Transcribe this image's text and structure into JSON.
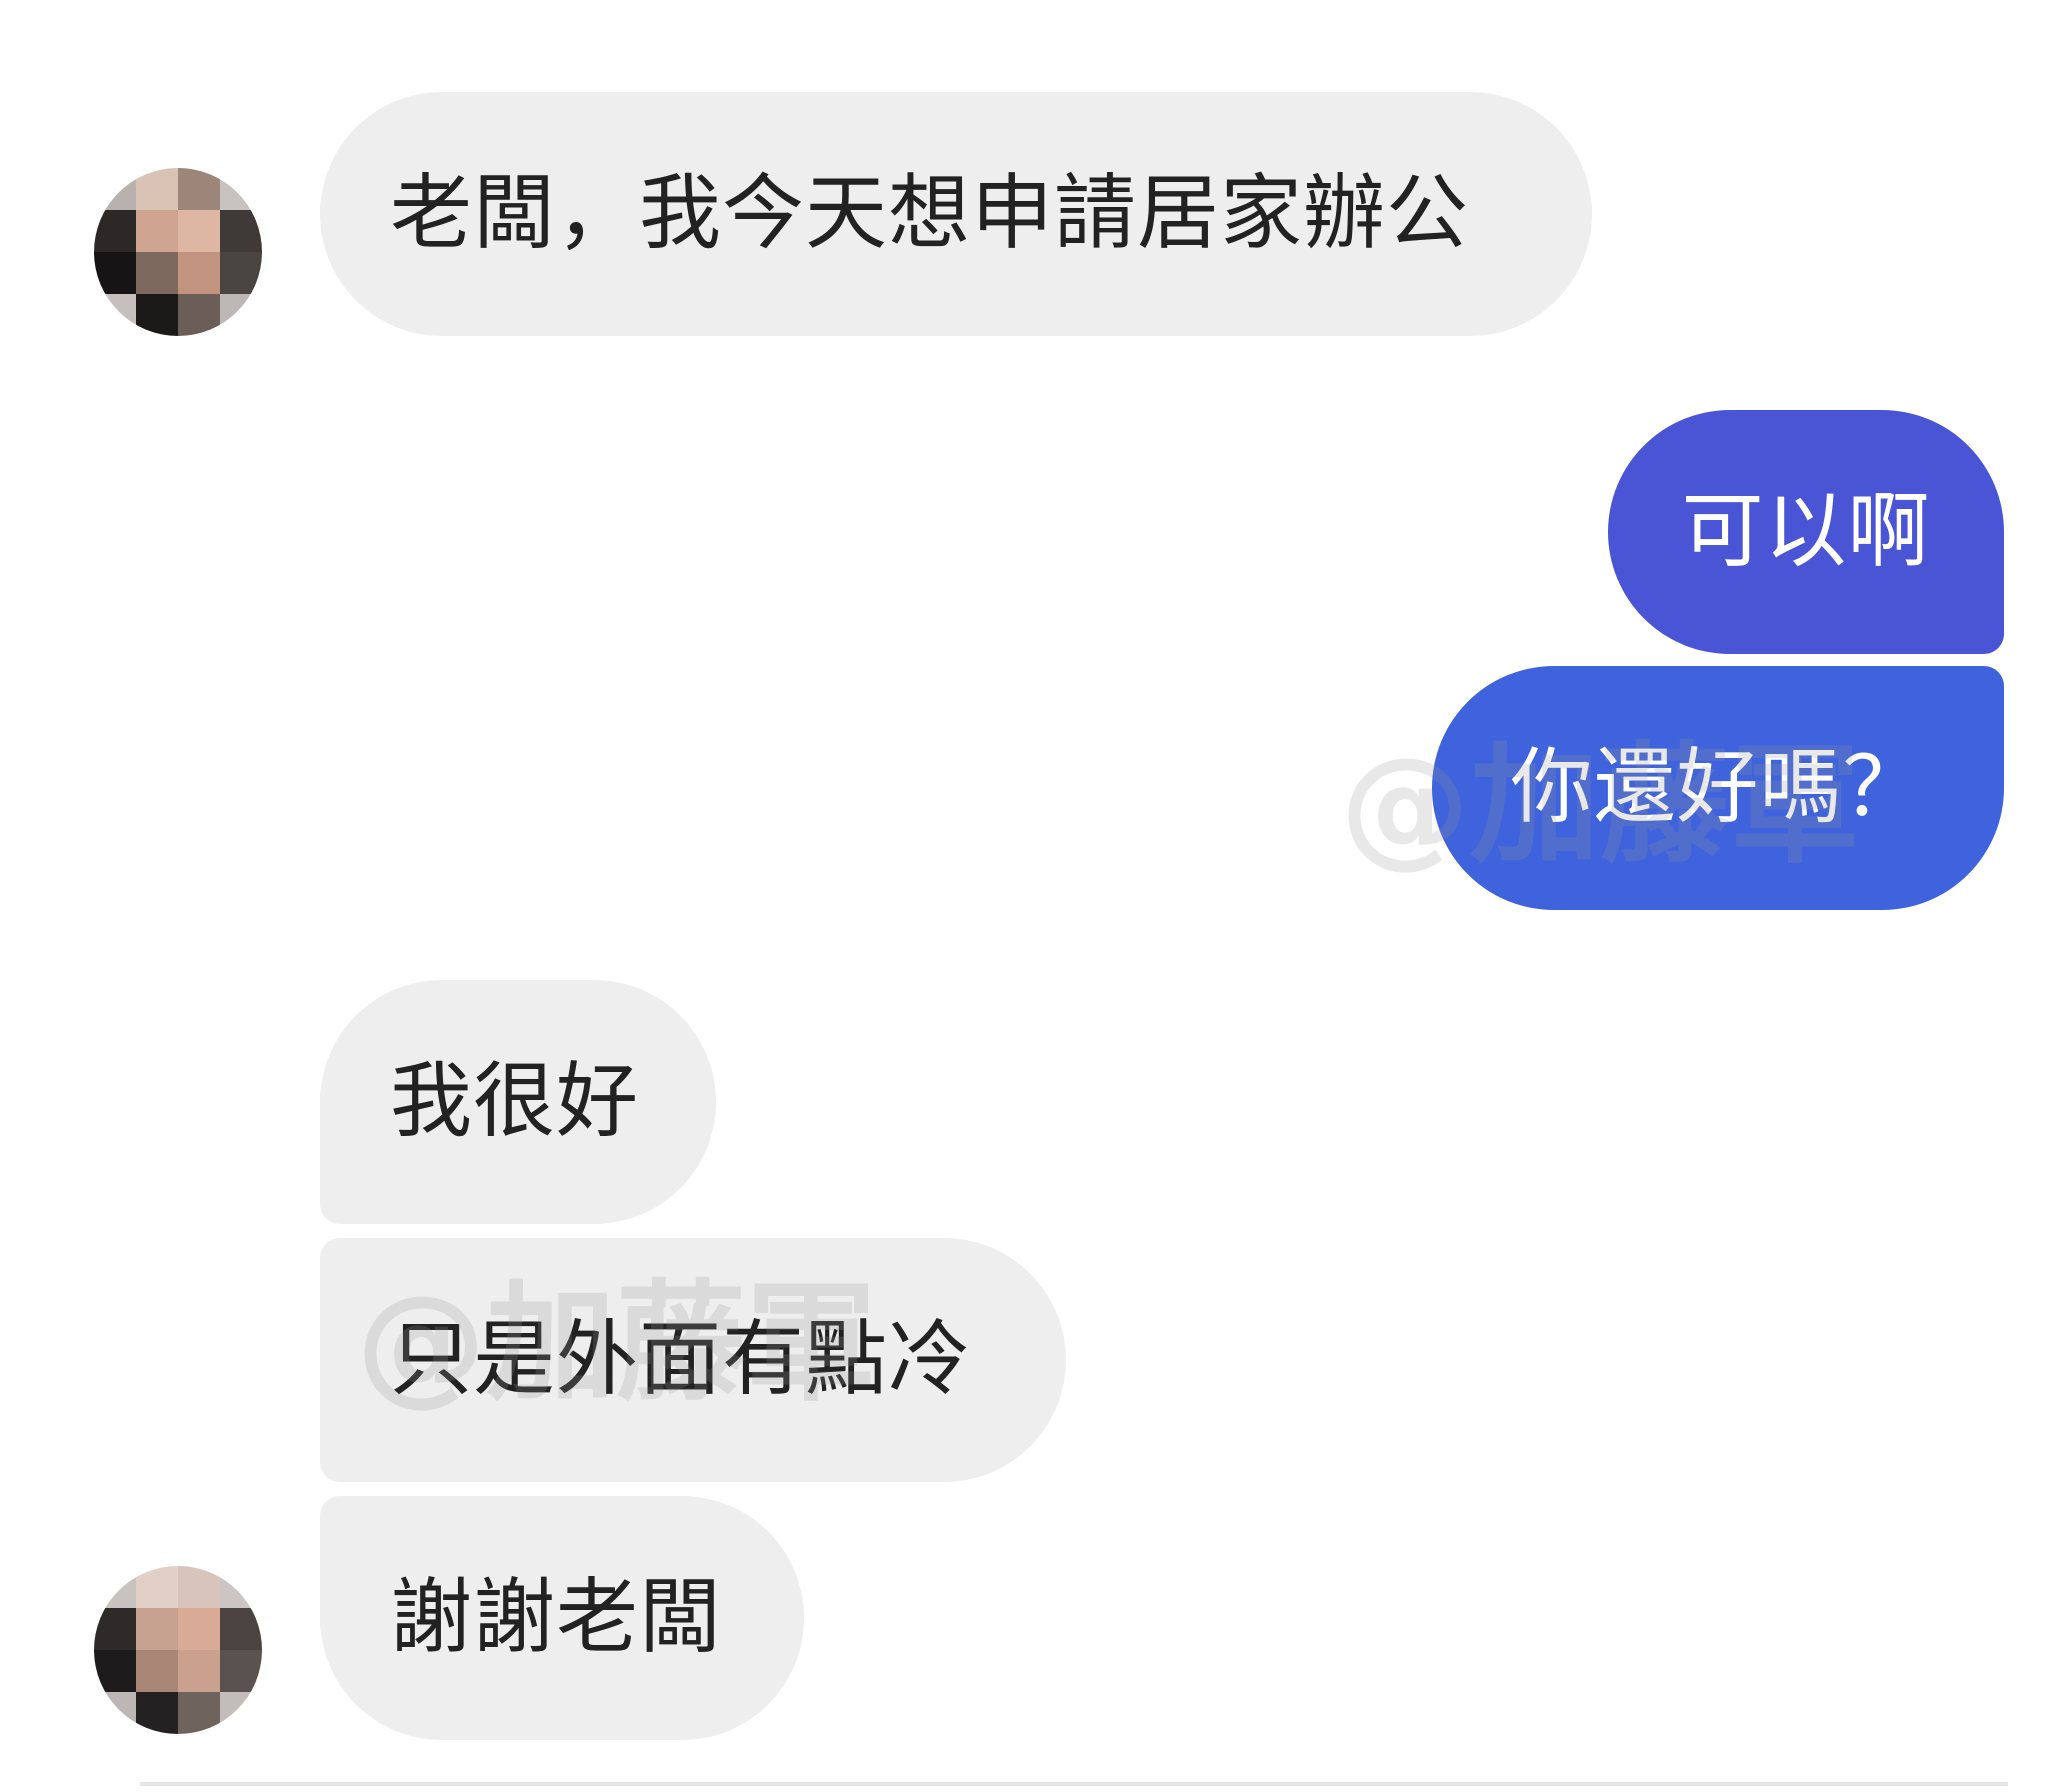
{
  "messages": [
    {
      "side": "incoming",
      "text": "老闆，我今天想申請居家辦公"
    },
    {
      "side": "outgoing",
      "text": "可以啊"
    },
    {
      "side": "outgoing",
      "text": "你還好嗎？"
    },
    {
      "side": "incoming",
      "text": "我很好"
    },
    {
      "side": "incoming",
      "text": "只是外面有點冷"
    },
    {
      "side": "incoming",
      "text": "謝謝老闆"
    }
  ],
  "watermark": "@加藤軍",
  "colors": {
    "incoming_bubble": "#eeeeee",
    "outgoing_bubble": "#4a55d6",
    "outgoing_bubble_2": "#3f63dd"
  }
}
